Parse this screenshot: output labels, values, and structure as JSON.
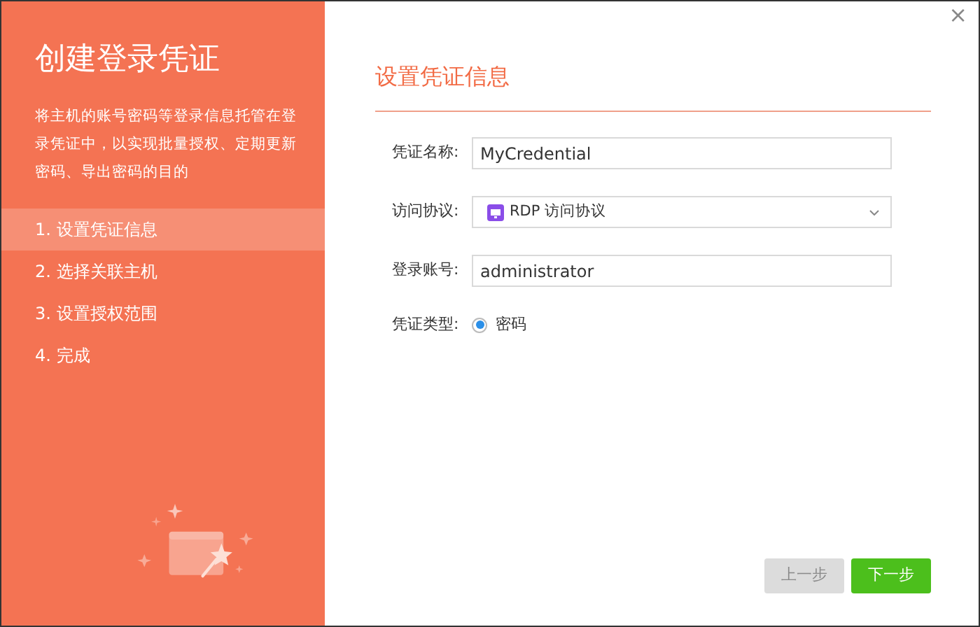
{
  "sidebar": {
    "title": "创建登录凭证",
    "description": "将主机的账号密码等登录信息托管在登录凭证中，以实现批量授权、定期更新密码、导出密码的目的",
    "steps": [
      {
        "label": "1. 设置凭证信息",
        "selected": true
      },
      {
        "label": "2. 选择关联主机",
        "selected": false
      },
      {
        "label": "3. 设置授权范围",
        "selected": false
      },
      {
        "label": "4. 完成",
        "selected": false
      }
    ]
  },
  "close": "×",
  "form": {
    "heading": "设置凭证信息",
    "fields": [
      {
        "kind": "text",
        "label": "凭证名称:",
        "value": "MyCredential"
      },
      {
        "kind": "select",
        "label": "访问协议:",
        "value": "RDP 访问协议"
      },
      {
        "kind": "text",
        "label": "登录账号:",
        "value": "administrator"
      },
      {
        "kind": "radio",
        "label": "凭证类型:",
        "options": [
          {
            "label": "密码",
            "selected": true
          }
        ]
      }
    ]
  },
  "buttons": [
    {
      "label": "上一步",
      "disabled": true
    },
    {
      "label": "下一步",
      "disabled": false
    }
  ]
}
